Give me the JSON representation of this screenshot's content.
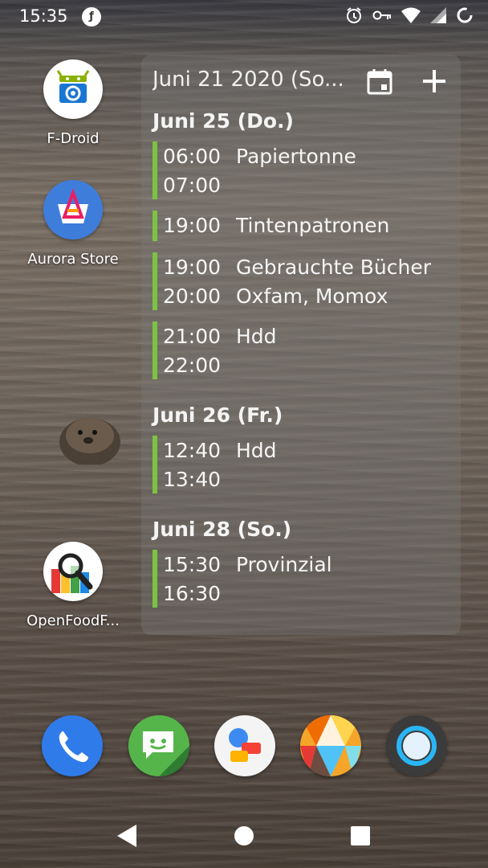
{
  "status_bar": {
    "time": "15:35",
    "notification_icon": "firefox-focus-icon",
    "right_icons": [
      "alarm-icon",
      "vpn-key-icon",
      "wifi-icon",
      "signal-icon",
      "battery-icon"
    ]
  },
  "home_apps": [
    {
      "label": "F-Droid",
      "icon": "fdroid-icon"
    },
    {
      "label": "Aurora Store",
      "icon": "aurora-store-icon"
    },
    {
      "label": "OpenFoodF...",
      "icon": "openfoodfacts-icon"
    }
  ],
  "widget": {
    "header_date": "Juni 21 2020 (So...",
    "calendar_icon": "calendar-icon",
    "add_icon": "add-icon",
    "accent_color": "#7cc243",
    "days": [
      {
        "heading": "Juni 25 (Do.)",
        "events": [
          {
            "start": "06:00",
            "title": "Papiertonne",
            "end": "07:00",
            "subtitle": ""
          },
          {
            "start": "19:00",
            "title": "Tintenpatronen",
            "end": "",
            "subtitle": ""
          },
          {
            "start": "19:00",
            "title": "Gebrauchte Bücher",
            "end": "20:00",
            "subtitle": "Oxfam, Momox"
          },
          {
            "start": "21:00",
            "title": "Hdd",
            "end": "22:00",
            "subtitle": ""
          }
        ]
      },
      {
        "heading": "Juni 26 (Fr.)",
        "events": [
          {
            "start": "12:40",
            "title": "Hdd",
            "end": "13:40",
            "subtitle": ""
          }
        ]
      },
      {
        "heading": "Juni 28 (So.)",
        "events": [
          {
            "start": "15:30",
            "title": "Provinzial",
            "end": "16:30",
            "subtitle": ""
          }
        ]
      }
    ]
  },
  "dock": [
    "phone-icon",
    "messaging-icon",
    "chat-icon",
    "gallery-icon",
    "browser-icon"
  ],
  "nav_bar": [
    "back-icon",
    "home-icon",
    "recents-icon"
  ]
}
